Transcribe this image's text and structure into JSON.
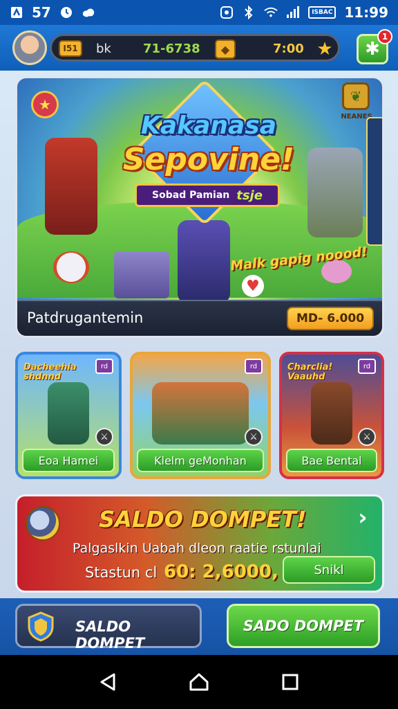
{
  "status_bar": {
    "left_number": "57",
    "battery_label": "ISBAC",
    "time": "11:99"
  },
  "top_bar": {
    "level_badge": "I51",
    "player_name": "bk",
    "gold": "71-6738",
    "timer": "7:00",
    "notification_count": "1"
  },
  "hero": {
    "logo_line1": "Kakanasa",
    "logo_line2": "Sepovine!",
    "ribbon_text": "Sobad Pamian",
    "ribbon_tag": "tsje",
    "top_right_label": "NEANES",
    "tagline": "Malk gapig noood!",
    "footer_label": "Patdrugantemin",
    "price": "MD- 6.000"
  },
  "cards": [
    {
      "title": "Dacheehia shdnnd",
      "badge": "rd",
      "button": "Eoa Hamei"
    },
    {
      "title": "",
      "badge": "rd",
      "button": "Klelm geMonhan"
    },
    {
      "title": "Charclia! Vaauhd",
      "badge": "rd",
      "button": "Bae Bental"
    }
  ],
  "wallet": {
    "title": "SALDO DOMPET!",
    "subtitle": "Palgaslkin Uabah dleon raatie rstunlai",
    "amount_label": "Stastun cl",
    "amount": "60: 2,6000,",
    "button": "Snikl"
  },
  "bottom_bar": {
    "left_label": "SALDO DOMPET",
    "right_label": "SADO DOMPET"
  },
  "colors": {
    "primary_blue": "#0b55b0",
    "accent_green": "#2c9c26",
    "accent_gold": "#ffd33a",
    "wallet_red": "#c51f2a"
  }
}
